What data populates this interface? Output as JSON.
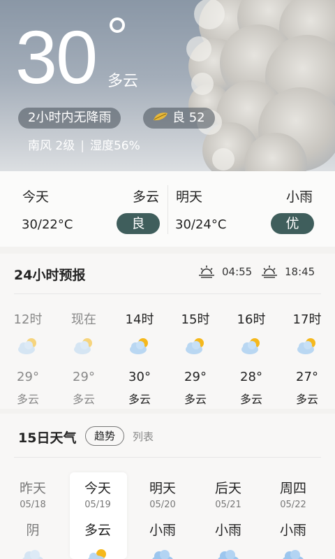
{
  "hero": {
    "temperature": "30",
    "condition": "多云",
    "rain_notice": "2小时内无降雨",
    "aqi_label": "良",
    "aqi_value": "52",
    "wind": "南风 2级",
    "separator": "|",
    "humidity": "湿度56%"
  },
  "daycard": {
    "today": {
      "label": "今天",
      "condition": "多云",
      "temp": "30/22°C",
      "aqi": "良"
    },
    "tomorrow": {
      "label": "明天",
      "condition": "小雨",
      "temp": "30/24°C",
      "aqi": "优"
    }
  },
  "hourly": {
    "title": "24小时预报",
    "sunrise": "04:55",
    "sunset": "18:45",
    "hours": [
      {
        "time": "12时",
        "temp": "29°",
        "cond": "多云",
        "icon": "partly-cloudy-icon"
      },
      {
        "time": "现在",
        "temp": "29°",
        "cond": "多云",
        "icon": "partly-cloudy-icon"
      },
      {
        "time": "14时",
        "temp": "30°",
        "cond": "多云",
        "icon": "partly-cloudy-icon"
      },
      {
        "time": "15时",
        "temp": "29°",
        "cond": "多云",
        "icon": "partly-cloudy-icon"
      },
      {
        "time": "16时",
        "temp": "28°",
        "cond": "多云",
        "icon": "partly-cloudy-icon"
      },
      {
        "time": "17时",
        "temp": "27°",
        "cond": "多云",
        "icon": "partly-cloudy-icon"
      }
    ]
  },
  "daily": {
    "title": "15日天气",
    "tab_trend": "趋势",
    "tab_list": "列表",
    "days": [
      {
        "name": "昨天",
        "date": "05/18",
        "cond": "阴",
        "icon": "cloud-icon"
      },
      {
        "name": "今天",
        "date": "05/19",
        "cond": "多云",
        "icon": "partly-cloudy-icon"
      },
      {
        "name": "明天",
        "date": "05/20",
        "cond": "小雨",
        "icon": "rain-cloud-icon"
      },
      {
        "name": "后天",
        "date": "05/21",
        "cond": "小雨",
        "icon": "rain-cloud-icon"
      },
      {
        "name": "周四",
        "date": "05/22",
        "cond": "小雨",
        "icon": "rain-cloud-icon"
      }
    ]
  },
  "colors": {
    "badge": "#3f5e5c",
    "sun": "#f5b81c"
  }
}
